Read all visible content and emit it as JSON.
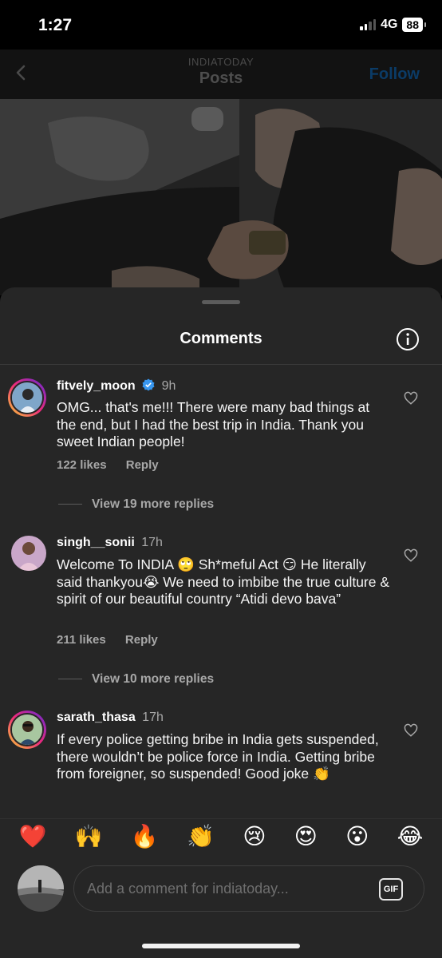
{
  "status_bar": {
    "time": "1:27",
    "network": "4G",
    "battery": "88"
  },
  "header": {
    "subtitle": "INDIATODAY",
    "title": "Posts",
    "follow_label": "Follow",
    "back_icon": "chevron-left-icon"
  },
  "sheet": {
    "title": "Comments",
    "info_icon": "info-icon"
  },
  "comments": [
    {
      "username": "fitvely_moon",
      "verified": true,
      "time": "9h",
      "text": "OMG... that's me!!! There were many bad things at the end, but I had the best trip in India. Thank you sweet Indian people!",
      "likes": "122 likes",
      "reply_label": "Reply",
      "more_replies": "View 19 more replies"
    },
    {
      "username": "singh__sonii",
      "verified": false,
      "time": "17h",
      "text": "Welcome To INDIA 🙄 Sh*meful Act 😏 He literally said thankyou😭 We need to imbibe the true culture & spirit of our beautiful country “Atidi devo bava”",
      "likes": "211 likes",
      "reply_label": "Reply",
      "more_replies": "View 10 more replies"
    },
    {
      "username": "sarath_thasa",
      "verified": false,
      "time": "17h",
      "text": "If every police getting bribe in India gets suspended, there wouldn’t be police force in India.  Getting  bribe from foreigner, so suspended! Good joke 👏"
    }
  ],
  "emoji_bar": [
    "❤️",
    "🙌",
    "🔥",
    "👏",
    "😢",
    "😍",
    "😮",
    "😂"
  ],
  "input": {
    "placeholder": "Add a comment for indiatoday...",
    "gif_label": "GIF"
  },
  "colors": {
    "accent": "#0095f6",
    "sheet_bg": "#262626",
    "secondary_text": "#a8a8a8"
  }
}
